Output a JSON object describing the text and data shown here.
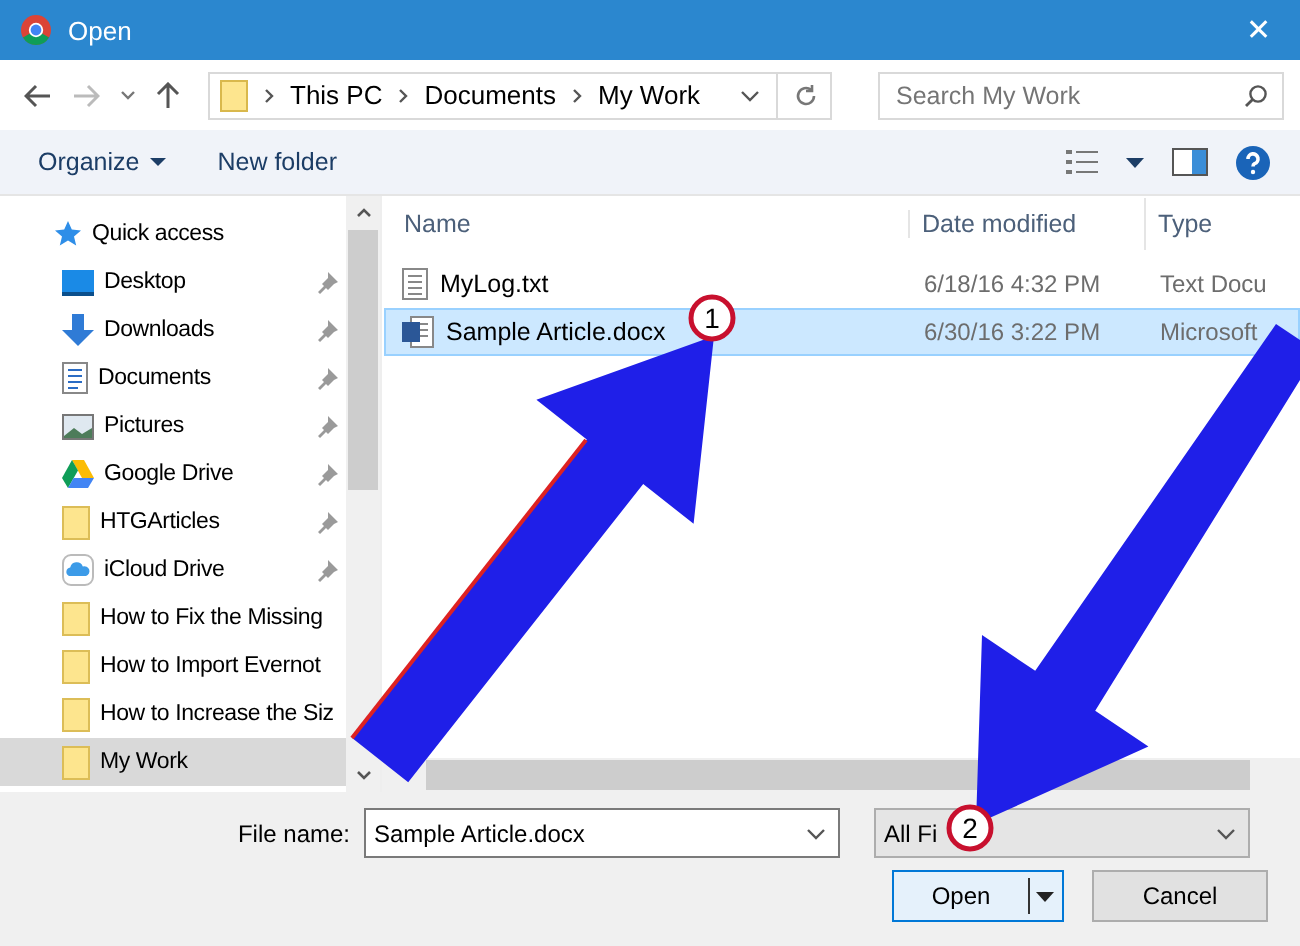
{
  "window": {
    "title": "Open",
    "close": "✕"
  },
  "address": {
    "crumbs": [
      "This PC",
      "Documents",
      "My Work"
    ],
    "search_placeholder": "Search My Work"
  },
  "toolbar": {
    "organize": "Organize",
    "new_folder": "New folder"
  },
  "nav": [
    {
      "label": "Quick access",
      "kind": "star",
      "pinned": false,
      "selected": false
    },
    {
      "label": "Desktop",
      "kind": "desktop",
      "pinned": true,
      "selected": false
    },
    {
      "label": "Downloads",
      "kind": "download",
      "pinned": true,
      "selected": false
    },
    {
      "label": "Documents",
      "kind": "document",
      "pinned": true,
      "selected": false
    },
    {
      "label": "Pictures",
      "kind": "picture",
      "pinned": true,
      "selected": false
    },
    {
      "label": "Google Drive",
      "kind": "drive",
      "pinned": true,
      "selected": false
    },
    {
      "label": "HTGArticles",
      "kind": "folder",
      "pinned": true,
      "selected": false
    },
    {
      "label": "iCloud Drive",
      "kind": "cloud",
      "pinned": true,
      "selected": false
    },
    {
      "label": "How to Fix the Missing",
      "kind": "folder",
      "pinned": false,
      "selected": false
    },
    {
      "label": "How to Import Evernot",
      "kind": "folder",
      "pinned": false,
      "selected": false
    },
    {
      "label": "How to Increase the Siz",
      "kind": "folder",
      "pinned": false,
      "selected": false
    },
    {
      "label": "My Work",
      "kind": "folder",
      "pinned": false,
      "selected": true
    }
  ],
  "table": {
    "columns": [
      "Name",
      "Date modified",
      "Type"
    ],
    "rows": [
      {
        "name": "MyLog.txt",
        "date": "6/18/16 4:32 PM",
        "type": "Text Docu",
        "kind": "text",
        "selected": false
      },
      {
        "name": "Sample Article.docx",
        "date": "6/30/16 3:22 PM",
        "type": "Microsoft",
        "kind": "word",
        "selected": true
      }
    ]
  },
  "footer": {
    "file_name_label": "File name:",
    "file_name": "Sample Article.docx",
    "file_type": "All Fi",
    "open": "Open",
    "cancel": "Cancel"
  },
  "callouts": [
    "1",
    "2"
  ]
}
